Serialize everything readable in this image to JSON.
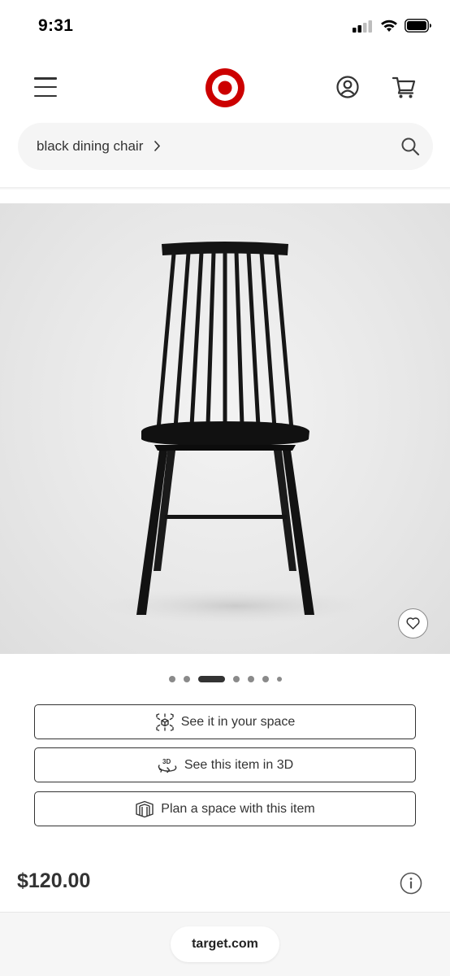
{
  "status_bar": {
    "time": "9:31",
    "icons": [
      "signal-icon",
      "wifi-icon",
      "battery-icon"
    ]
  },
  "header": {
    "icons": [
      "menu-icon",
      "target-logo",
      "account-icon",
      "cart-icon"
    ]
  },
  "search": {
    "query": "black dining chair",
    "icon": "search-icon"
  },
  "gallery": {
    "image_count": 7,
    "active_index": 2,
    "favorite_icon": "heart-icon"
  },
  "actions": {
    "see_in_space": "See it in your space",
    "see_in_3d": "See this item in 3D",
    "plan_space": "Plan a space with this item"
  },
  "product": {
    "price": "$120.00"
  },
  "browser": {
    "url": "target.com"
  },
  "colors": {
    "brand_red": "#cc0000",
    "text_dark": "#333333"
  }
}
